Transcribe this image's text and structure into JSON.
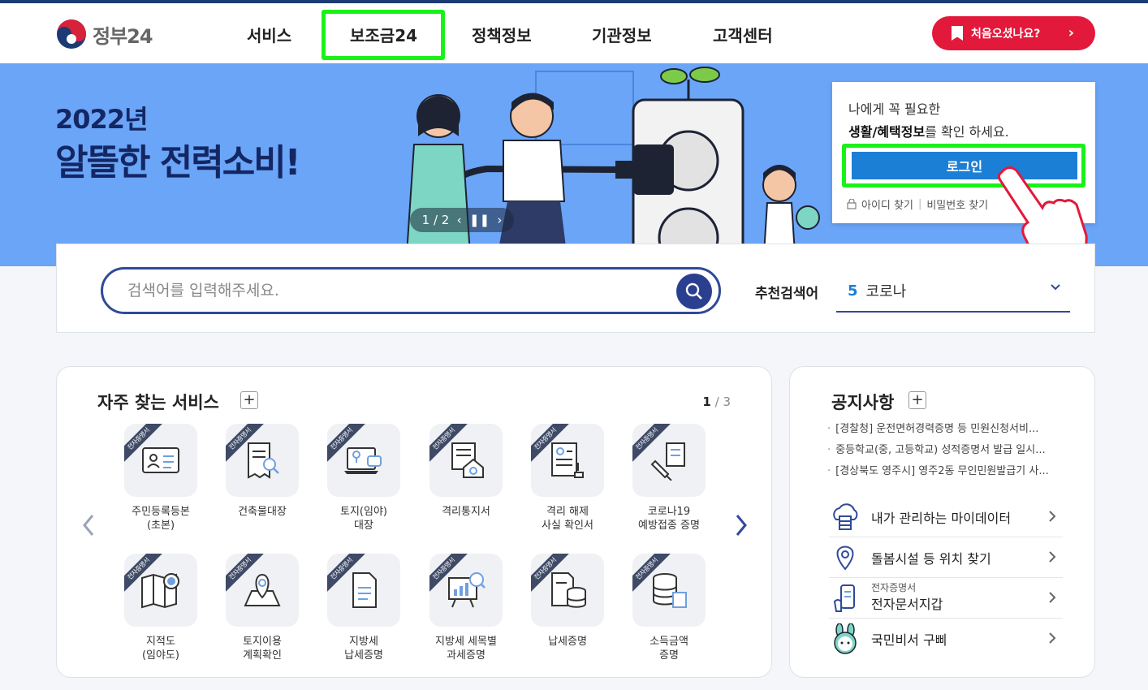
{
  "header": {
    "logo_text": "정부24",
    "nav": [
      "서비스",
      "보조금24",
      "정책정보",
      "기관정보",
      "고객센터"
    ],
    "first_visit": "처음오셨나요?"
  },
  "banner": {
    "year": "2022년",
    "title": "알뜰한 전력소비!",
    "pager": {
      "current": "1",
      "total": "2",
      "display": "1 / 2"
    }
  },
  "login": {
    "line1": "나에게 꼭 필요한",
    "line2_bold": "생활/혜택정보",
    "line2_rest": "를 확인 하세요.",
    "button": "로그인",
    "find_id": "아이디 찾기",
    "find_pw": "비밀번호 찾기"
  },
  "search": {
    "placeholder": "검색어를 입력해주세요.",
    "rec_label": "추천검색어",
    "rec_number": "5",
    "rec_keyword": "코로나"
  },
  "services": {
    "title": "자주 찾는 서비스",
    "page_current": "1",
    "page_total": "/ 3",
    "badge": "전자증명서",
    "items": [
      {
        "line1": "주민등록등본",
        "line2": "(초본)"
      },
      {
        "line1": "건축물대장",
        "line2": ""
      },
      {
        "line1": "토지(임야)",
        "line2": "대장"
      },
      {
        "line1": "격리통지서",
        "line2": ""
      },
      {
        "line1": "격리 해제",
        "line2": "사실 확인서"
      },
      {
        "line1": "코로나19",
        "line2": "예방접종 증명"
      },
      {
        "line1": "지적도",
        "line2": "(임야도)"
      },
      {
        "line1": "토지이용",
        "line2": "계획확인"
      },
      {
        "line1": "지방세",
        "line2": "납세증명"
      },
      {
        "line1": "지방세 세목별",
        "line2": "과세증명"
      },
      {
        "line1": "납세증명",
        "line2": ""
      },
      {
        "line1": "소득금액",
        "line2": "증명"
      }
    ]
  },
  "notice": {
    "title": "공지사항",
    "items": [
      "[경찰청] 운전면허경력증명 등 민원신청서비...",
      "중등학교(중, 고등학교) 성적증명서 발급 일시...",
      "[경상북도 영주시] 영주2동 무인민원발급기 사..."
    ],
    "quick": [
      {
        "label": "내가 관리하는 마이데이터",
        "sub": ""
      },
      {
        "label": "돌봄시설 등 위치 찾기",
        "sub": ""
      },
      {
        "label": "전자문서지갑",
        "sub": "전자증명서"
      },
      {
        "label": "국민비서 구삐",
        "sub": ""
      }
    ]
  }
}
